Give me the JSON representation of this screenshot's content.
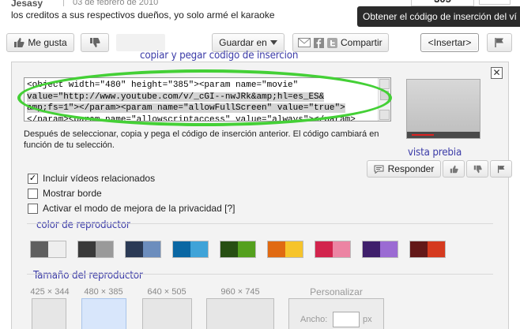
{
  "comment": {
    "author": "Jesasy",
    "date": "03 de febrero de 2010",
    "text": "los creditos a sus respectivos dueños, yo solo armé el karaoke",
    "views_partial": "305"
  },
  "tooltip": "Obtener el código de inserción del ví",
  "actions": {
    "like": "Me gusta",
    "save": "Guardar en",
    "share": "Compartir",
    "embed": "<Insertar>"
  },
  "embed_panel": {
    "annotation_copy": "copiar y pegar codigo de insercion",
    "annotation_preview": "vista prebia",
    "annotation_color": "color de reproductor",
    "annotation_size": "Tamaño del reproductor",
    "code_lines": [
      "<object width=\"480\" height=\"385\"><param name=\"movie\"",
      "value=\"http://www.youtube.com/v/_cGI--nwJRk&amp;hl=es_ES&",
      "amp;fs=1\"></param><param name=\"allowFullScreen\" value=\"true\">",
      "</param><param name=\"allowscriptaccess\" value=\"always\"></param>"
    ],
    "help_text": "Después de seleccionar, copia y pega el código de inserción anterior. El código cambiará en función de tu selección.",
    "respond_label": "Responder",
    "options": [
      {
        "label": "Incluir vídeos relacionados",
        "checked": true
      },
      {
        "label": "Mostrar borde",
        "checked": false
      },
      {
        "label": "Activar el modo de mejora de la privacidad [?]",
        "checked": false
      }
    ],
    "color_swatches": [
      [
        "#5f5f5f",
        "#eeeeee"
      ],
      [
        "#3a3a3a",
        "#9a9a9a"
      ],
      [
        "#2b3a55",
        "#6c8dbd"
      ],
      [
        "#0a67a3",
        "#3fa3d8"
      ],
      [
        "#264e12",
        "#54a01e"
      ],
      [
        "#e06a12",
        "#f6c42b"
      ],
      [
        "#d2244d",
        "#ec84a3"
      ],
      [
        "#3f1f6b",
        "#9b6bd3"
      ],
      [
        "#631818",
        "#d53a1f"
      ]
    ],
    "sizes": [
      {
        "label": "425 × 344",
        "selected": false
      },
      {
        "label": "480 × 385",
        "selected": true
      },
      {
        "label": "640 × 505",
        "selected": false
      },
      {
        "label": "960 × 745",
        "selected": false
      }
    ],
    "custom_label": "Personalizar",
    "width_label": "Ancho:",
    "px_label": "px"
  }
}
